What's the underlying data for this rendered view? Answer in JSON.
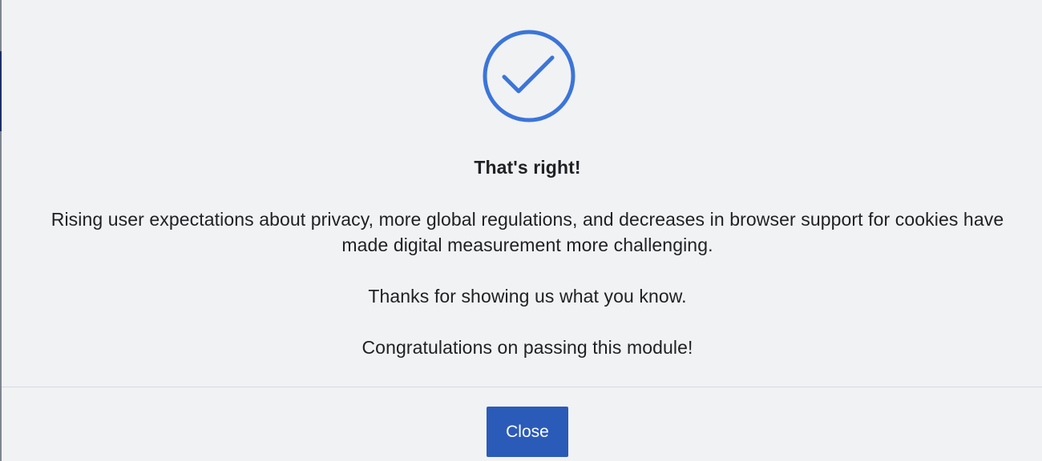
{
  "dialog": {
    "icon": "checkmark-circle-icon",
    "accent_color": "#3b75d9",
    "title": "That's right!",
    "paragraphs": [
      "Rising user expectations about privacy, more global regulations, and decreases in browser support for cookies have made digital measurement more challenging.",
      "Thanks for showing us what you know.",
      "Congratulations on passing this module!"
    ],
    "close_label": "Close",
    "button_color": "#2b5bb8"
  }
}
